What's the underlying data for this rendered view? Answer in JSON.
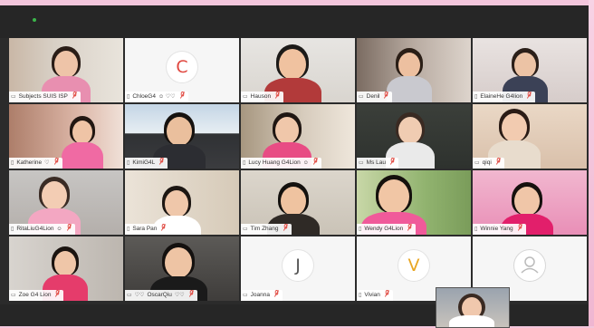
{
  "window": {
    "accent_color": "#3bb54a"
  },
  "participants": [
    {
      "name": "Subjects SUIS ISP",
      "device": "desktop",
      "muted": true,
      "video": true
    },
    {
      "name": "ChloeG4",
      "device": "mobile",
      "muted": true,
      "video": false,
      "initial": "C",
      "initial_color": "#e0473f",
      "extras": "☺ ♡♡"
    },
    {
      "name": "Hauson",
      "device": "desktop",
      "muted": true,
      "video": true
    },
    {
      "name": "Denil",
      "device": "desktop",
      "muted": true,
      "video": true
    },
    {
      "name": "ElaineHe G4lion",
      "device": "mobile",
      "muted": true,
      "video": true
    },
    {
      "name": "Katherine",
      "device": "mobile",
      "muted": true,
      "video": true,
      "extras": "♡"
    },
    {
      "name": "KimiG4L",
      "device": "mobile",
      "muted": true,
      "video": true
    },
    {
      "name": "Lucy Huang G4Lion",
      "device": "mobile",
      "muted": true,
      "video": true,
      "extras": "☺"
    },
    {
      "name": "Ms Lau",
      "device": "desktop",
      "muted": true,
      "video": true
    },
    {
      "name": "qiqi",
      "device": "desktop",
      "muted": true,
      "video": true
    },
    {
      "name": "RitaLiuG4Lion",
      "device": "mobile",
      "muted": true,
      "video": true,
      "extras": "☺"
    },
    {
      "name": "Sara Pan",
      "device": "mobile",
      "muted": true,
      "video": true
    },
    {
      "name": "Tim Zhang",
      "device": "desktop",
      "muted": true,
      "video": true
    },
    {
      "name": "Wendy G4Lion",
      "device": "mobile",
      "muted": true,
      "video": true
    },
    {
      "name": "Winnie Yang",
      "device": "mobile",
      "muted": true,
      "video": true
    },
    {
      "name": "Zoe G4 Lion",
      "device": "desktop",
      "muted": true,
      "video": true
    },
    {
      "name": "OscarQiu",
      "device": "desktop",
      "muted": true,
      "video": true,
      "prefix": "♡♡",
      "extras": "♡♡"
    },
    {
      "name": "Joanna",
      "device": "desktop",
      "muted": true,
      "video": false,
      "initial": "J",
      "initial_color": "#555555"
    },
    {
      "name": "Vivian",
      "device": "mobile",
      "muted": true,
      "video": false,
      "initial": "V",
      "initial_color": "#e8a623"
    },
    {
      "name": "",
      "device": "none",
      "muted": true,
      "video": false,
      "initial": "",
      "initial_color": "#bbbbbb"
    }
  ],
  "icons": {
    "desktop": "▭",
    "mobile": "▯",
    "muted": "⚙"
  }
}
